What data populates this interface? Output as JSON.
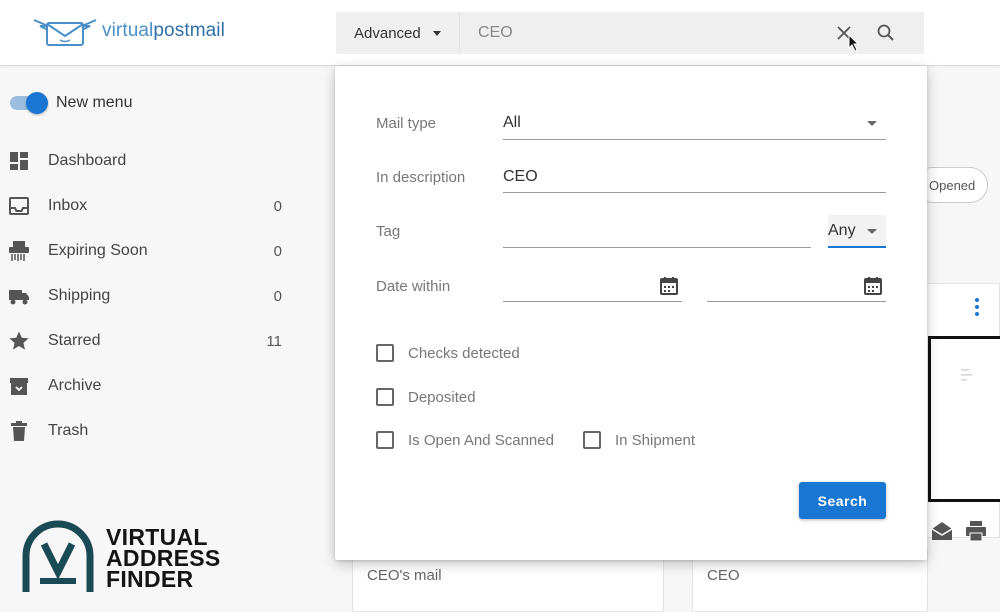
{
  "brand": {
    "logo_text_light": "virtual",
    "logo_text_bold": "postmail"
  },
  "search": {
    "mode_label": "Advanced",
    "query": "CEO",
    "placeholder": ""
  },
  "sidebar": {
    "toggle_label": "New menu",
    "toggle_on": true,
    "items": [
      {
        "icon": "dashboard-icon",
        "label": "Dashboard",
        "count": ""
      },
      {
        "icon": "inbox-icon",
        "label": "Inbox",
        "count": "0"
      },
      {
        "icon": "shredder-icon",
        "label": "Expiring Soon",
        "count": "0"
      },
      {
        "icon": "truck-icon",
        "label": "Shipping",
        "count": "0"
      },
      {
        "icon": "star-icon",
        "label": "Starred",
        "count": "11"
      },
      {
        "icon": "archive-icon",
        "label": "Archive",
        "count": ""
      },
      {
        "icon": "trash-icon",
        "label": "Trash",
        "count": ""
      }
    ]
  },
  "advanced_search": {
    "mail_type": {
      "label": "Mail type",
      "value": "All"
    },
    "description": {
      "label": "In description",
      "value": "CEO"
    },
    "tag": {
      "label": "Tag",
      "value": "",
      "match": "Any"
    },
    "date": {
      "label": "Date within",
      "from": "",
      "to": ""
    },
    "checkboxes": [
      {
        "label": "Checks detected",
        "checked": false
      },
      {
        "label": "Deposited",
        "checked": false
      },
      {
        "label": "Is Open And Scanned",
        "checked": false
      },
      {
        "label": "In Shipment",
        "checked": false
      }
    ],
    "submit_label": "Search"
  },
  "background": {
    "opened_chip": "Opened",
    "cards": [
      {
        "title": "CEO's mail"
      },
      {
        "title": "CEO"
      }
    ]
  },
  "watermark": {
    "line1": "VIRTUAL",
    "line2": "ADDRESS",
    "line3": "FINDER"
  },
  "colors": {
    "accent": "#1976d2",
    "logo": "#4a90c8",
    "watermark": "#1b4a57"
  }
}
